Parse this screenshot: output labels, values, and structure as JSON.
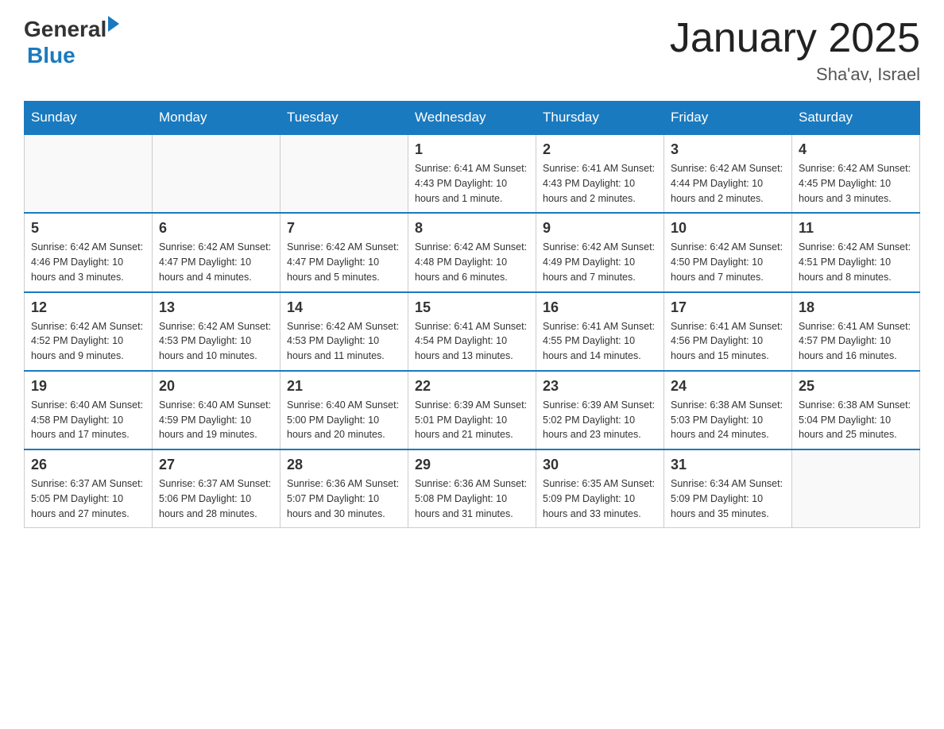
{
  "header": {
    "logo": {
      "general_text": "General",
      "blue_text": "Blue"
    },
    "title": "January 2025",
    "subtitle": "Sha'av, Israel"
  },
  "days_of_week": [
    "Sunday",
    "Monday",
    "Tuesday",
    "Wednesday",
    "Thursday",
    "Friday",
    "Saturday"
  ],
  "weeks": [
    [
      {
        "day": "",
        "info": ""
      },
      {
        "day": "",
        "info": ""
      },
      {
        "day": "",
        "info": ""
      },
      {
        "day": "1",
        "info": "Sunrise: 6:41 AM\nSunset: 4:43 PM\nDaylight: 10 hours and 1 minute."
      },
      {
        "day": "2",
        "info": "Sunrise: 6:41 AM\nSunset: 4:43 PM\nDaylight: 10 hours and 2 minutes."
      },
      {
        "day": "3",
        "info": "Sunrise: 6:42 AM\nSunset: 4:44 PM\nDaylight: 10 hours and 2 minutes."
      },
      {
        "day": "4",
        "info": "Sunrise: 6:42 AM\nSunset: 4:45 PM\nDaylight: 10 hours and 3 minutes."
      }
    ],
    [
      {
        "day": "5",
        "info": "Sunrise: 6:42 AM\nSunset: 4:46 PM\nDaylight: 10 hours and 3 minutes."
      },
      {
        "day": "6",
        "info": "Sunrise: 6:42 AM\nSunset: 4:47 PM\nDaylight: 10 hours and 4 minutes."
      },
      {
        "day": "7",
        "info": "Sunrise: 6:42 AM\nSunset: 4:47 PM\nDaylight: 10 hours and 5 minutes."
      },
      {
        "day": "8",
        "info": "Sunrise: 6:42 AM\nSunset: 4:48 PM\nDaylight: 10 hours and 6 minutes."
      },
      {
        "day": "9",
        "info": "Sunrise: 6:42 AM\nSunset: 4:49 PM\nDaylight: 10 hours and 7 minutes."
      },
      {
        "day": "10",
        "info": "Sunrise: 6:42 AM\nSunset: 4:50 PM\nDaylight: 10 hours and 7 minutes."
      },
      {
        "day": "11",
        "info": "Sunrise: 6:42 AM\nSunset: 4:51 PM\nDaylight: 10 hours and 8 minutes."
      }
    ],
    [
      {
        "day": "12",
        "info": "Sunrise: 6:42 AM\nSunset: 4:52 PM\nDaylight: 10 hours and 9 minutes."
      },
      {
        "day": "13",
        "info": "Sunrise: 6:42 AM\nSunset: 4:53 PM\nDaylight: 10 hours and 10 minutes."
      },
      {
        "day": "14",
        "info": "Sunrise: 6:42 AM\nSunset: 4:53 PM\nDaylight: 10 hours and 11 minutes."
      },
      {
        "day": "15",
        "info": "Sunrise: 6:41 AM\nSunset: 4:54 PM\nDaylight: 10 hours and 13 minutes."
      },
      {
        "day": "16",
        "info": "Sunrise: 6:41 AM\nSunset: 4:55 PM\nDaylight: 10 hours and 14 minutes."
      },
      {
        "day": "17",
        "info": "Sunrise: 6:41 AM\nSunset: 4:56 PM\nDaylight: 10 hours and 15 minutes."
      },
      {
        "day": "18",
        "info": "Sunrise: 6:41 AM\nSunset: 4:57 PM\nDaylight: 10 hours and 16 minutes."
      }
    ],
    [
      {
        "day": "19",
        "info": "Sunrise: 6:40 AM\nSunset: 4:58 PM\nDaylight: 10 hours and 17 minutes."
      },
      {
        "day": "20",
        "info": "Sunrise: 6:40 AM\nSunset: 4:59 PM\nDaylight: 10 hours and 19 minutes."
      },
      {
        "day": "21",
        "info": "Sunrise: 6:40 AM\nSunset: 5:00 PM\nDaylight: 10 hours and 20 minutes."
      },
      {
        "day": "22",
        "info": "Sunrise: 6:39 AM\nSunset: 5:01 PM\nDaylight: 10 hours and 21 minutes."
      },
      {
        "day": "23",
        "info": "Sunrise: 6:39 AM\nSunset: 5:02 PM\nDaylight: 10 hours and 23 minutes."
      },
      {
        "day": "24",
        "info": "Sunrise: 6:38 AM\nSunset: 5:03 PM\nDaylight: 10 hours and 24 minutes."
      },
      {
        "day": "25",
        "info": "Sunrise: 6:38 AM\nSunset: 5:04 PM\nDaylight: 10 hours and 25 minutes."
      }
    ],
    [
      {
        "day": "26",
        "info": "Sunrise: 6:37 AM\nSunset: 5:05 PM\nDaylight: 10 hours and 27 minutes."
      },
      {
        "day": "27",
        "info": "Sunrise: 6:37 AM\nSunset: 5:06 PM\nDaylight: 10 hours and 28 minutes."
      },
      {
        "day": "28",
        "info": "Sunrise: 6:36 AM\nSunset: 5:07 PM\nDaylight: 10 hours and 30 minutes."
      },
      {
        "day": "29",
        "info": "Sunrise: 6:36 AM\nSunset: 5:08 PM\nDaylight: 10 hours and 31 minutes."
      },
      {
        "day": "30",
        "info": "Sunrise: 6:35 AM\nSunset: 5:09 PM\nDaylight: 10 hours and 33 minutes."
      },
      {
        "day": "31",
        "info": "Sunrise: 6:34 AM\nSunset: 5:09 PM\nDaylight: 10 hours and 35 minutes."
      },
      {
        "day": "",
        "info": ""
      }
    ]
  ]
}
